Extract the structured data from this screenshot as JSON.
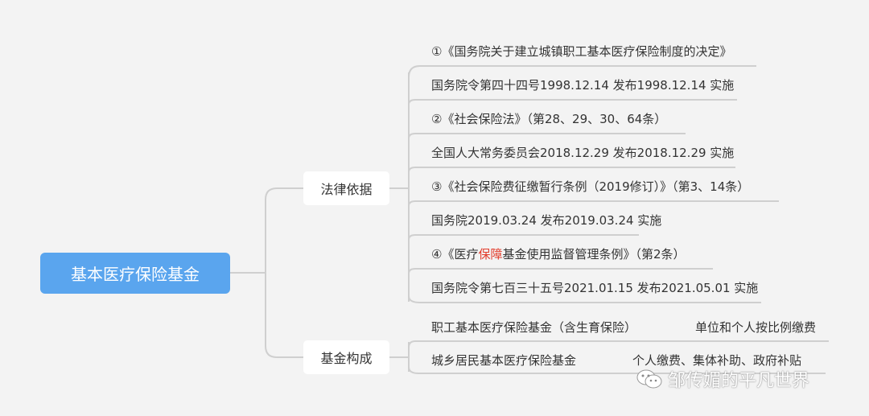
{
  "root": {
    "label": "基本医疗保险基金"
  },
  "branches": [
    {
      "label": "法律依据",
      "leaves": [
        {
          "pre": "①《国务院关于建立城镇职工基本医疗保险制度的决定》",
          "hl": "",
          "post": ""
        },
        {
          "pre": "国务院令第四十四号1998.12.14 发布1998.12.14 实施",
          "hl": "",
          "post": ""
        },
        {
          "pre": "②《社会保险法》（第28、29、30、64条）",
          "hl": "",
          "post": ""
        },
        {
          "pre": "全国人大常务委员会2018.12.29 发布2018.12.29 实施",
          "hl": "",
          "post": ""
        },
        {
          "pre": "③《社会保险费征缴暂行条例（2019修订）》（第3、14条）",
          "hl": "",
          "post": ""
        },
        {
          "pre": "国务院2019.03.24 发布2019.03.24 实施",
          "hl": "",
          "post": ""
        },
        {
          "pre": "④《医疗",
          "hl": "保障",
          "post": "基金使用监督管理条例》（第2条）"
        },
        {
          "pre": "国务院令第七百三十五号2021.01.15 发布2021.05.01 实施",
          "hl": "",
          "post": ""
        }
      ]
    },
    {
      "label": "基金构成",
      "leaves": [
        {
          "pre": "职工基本医疗保险基金（含生育保险）",
          "hl": "",
          "post": "",
          "side": "单位和个人按比例缴费"
        },
        {
          "pre": "城乡居民基本医疗保险基金",
          "hl": "",
          "post": "",
          "side": "个人缴费、集体补助、政府补贴"
        }
      ]
    }
  ],
  "watermark": {
    "text": "邹传媚的平凡世界",
    "icon": "wechat-icon"
  },
  "colors": {
    "root_bg": "#5aa5ee",
    "line": "#cfcfcf",
    "highlight": "#e23b2a",
    "background": "#f3f3f3"
  }
}
